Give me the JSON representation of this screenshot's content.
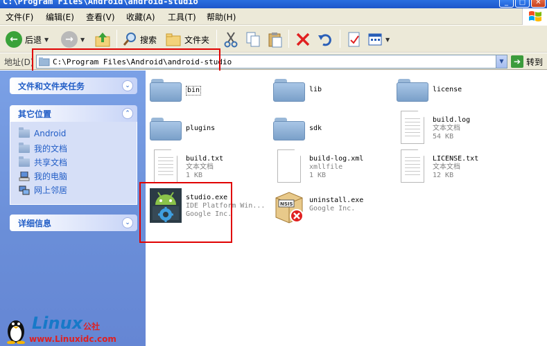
{
  "window": {
    "title": "C:\\Program Files\\Android\\android-studio",
    "buttons": [
      "_",
      "□",
      "✕"
    ]
  },
  "menu": [
    "文件(F)",
    "编辑(E)",
    "查看(V)",
    "收藏(A)",
    "工具(T)",
    "帮助(H)"
  ],
  "toolbar": {
    "back_label": "后退",
    "search_label": "搜索",
    "folders_label": "文件夹"
  },
  "address": {
    "label": "地址(D)",
    "value": "C:\\Program Files\\Android\\android-studio",
    "go_label": "转到"
  },
  "left_pane": {
    "tasks_header": "文件和文件夹任务",
    "places_header": "其它位置",
    "places": [
      "Android",
      "我的文档",
      "共享文档",
      "我的电脑",
      "网上邻居"
    ],
    "details_header": "详细信息"
  },
  "files": [
    {
      "name": "bin",
      "type": "folder"
    },
    {
      "name": "lib",
      "type": "folder"
    },
    {
      "name": "license",
      "type": "folder"
    },
    {
      "name": "plugins",
      "type": "folder"
    },
    {
      "name": "sdk",
      "type": "folder"
    },
    {
      "name": "build.log",
      "desc": "文本文档",
      "size": "54 KB",
      "type": "text"
    },
    {
      "name": "build.txt",
      "desc": "文本文档",
      "size": "1 KB",
      "type": "text"
    },
    {
      "name": "build-log.xml",
      "desc": "xmllfile",
      "size": "1 KB",
      "type": "blank"
    },
    {
      "name": "LICENSE.txt",
      "desc": "文本文档",
      "size": "12 KB",
      "type": "text"
    },
    {
      "name": "studio.exe",
      "desc": "IDE Platform Win...",
      "size": "Google Inc.",
      "type": "exe-android"
    },
    {
      "name": "uninstall.exe",
      "desc": "Google Inc.",
      "type": "exe-nsis"
    }
  ],
  "watermark": {
    "logo": "Linux",
    "cn": "公社",
    "url": "www.Linuxidc.com"
  },
  "colors": {
    "highlight": "#e00000",
    "task_pane": "#6a8ed8",
    "link": "#215dc6"
  }
}
